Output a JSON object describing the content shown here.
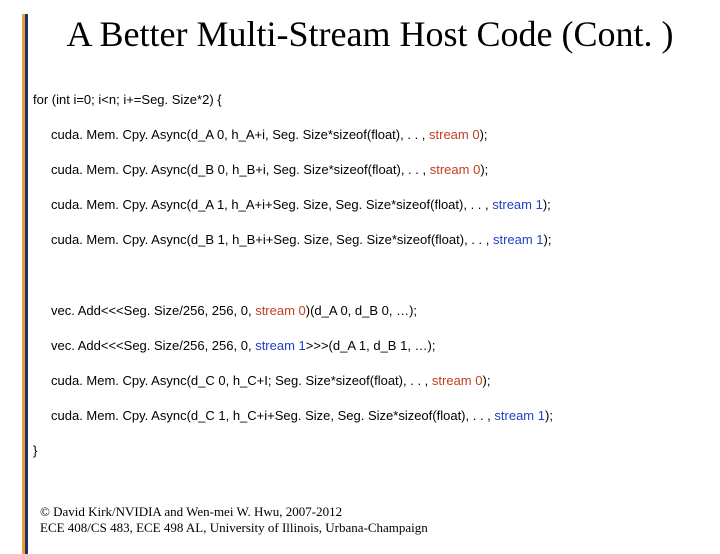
{
  "title": "A Better Multi-Stream Host Code (Cont. )",
  "code": {
    "for_line": "for (int i=0; i<n; i+=Seg. Size*2) {",
    "l1a": "cuda. Mem. Cpy. Async(d_A 0, h_A+i, Seg. Size*sizeof(float), . . , ",
    "l1b": "stream 0",
    "l1c": ");",
    "l2a": "cuda. Mem. Cpy. Async(d_B 0, h_B+i, Seg. Size*sizeof(float), . . , ",
    "l2b": "stream 0",
    "l2c": ");",
    "l3a": "cuda. Mem. Cpy. Async(d_A 1, h_A+i+Seg. Size, Seg. Size*sizeof(float), . . , ",
    "l3b": "stream 1",
    "l3c": ");",
    "l4a": "cuda. Mem. Cpy. Async(d_B 1, h_B+i+Seg. Size, Seg. Size*sizeof(float), . . , ",
    "l4b": "stream 1",
    "l4c": ");",
    "l5a": "vec. Add<<<Seg. Size/256, 256, 0, ",
    "l5b": "stream 0",
    "l5c": ")(d_A 0, d_B 0, …);",
    "l6a": "vec. Add<<<Seg. Size/256, 256, 0, ",
    "l6b": "stream 1",
    "l6c": ">>>(d_A 1, d_B 1, …);",
    "l7a": "cuda. Mem. Cpy. Async(d_C 0, h_C+I; Seg. Size*sizeof(float), . . , ",
    "l7b": "stream 0",
    "l7c": ");",
    "l8a": "cuda. Mem. Cpy. Async(d_C 1, h_C+i+Seg. Size, Seg. Size*sizeof(float), . . , ",
    "l8b": "stream 1",
    "l8c": ");",
    "close": "}"
  },
  "footer": {
    "line1": "© David Kirk/NVIDIA and Wen-mei W. Hwu, 2007-2012",
    "line2": "ECE 408/CS 483, ECE 498 AL, University of Illinois, Urbana-Champaign"
  }
}
